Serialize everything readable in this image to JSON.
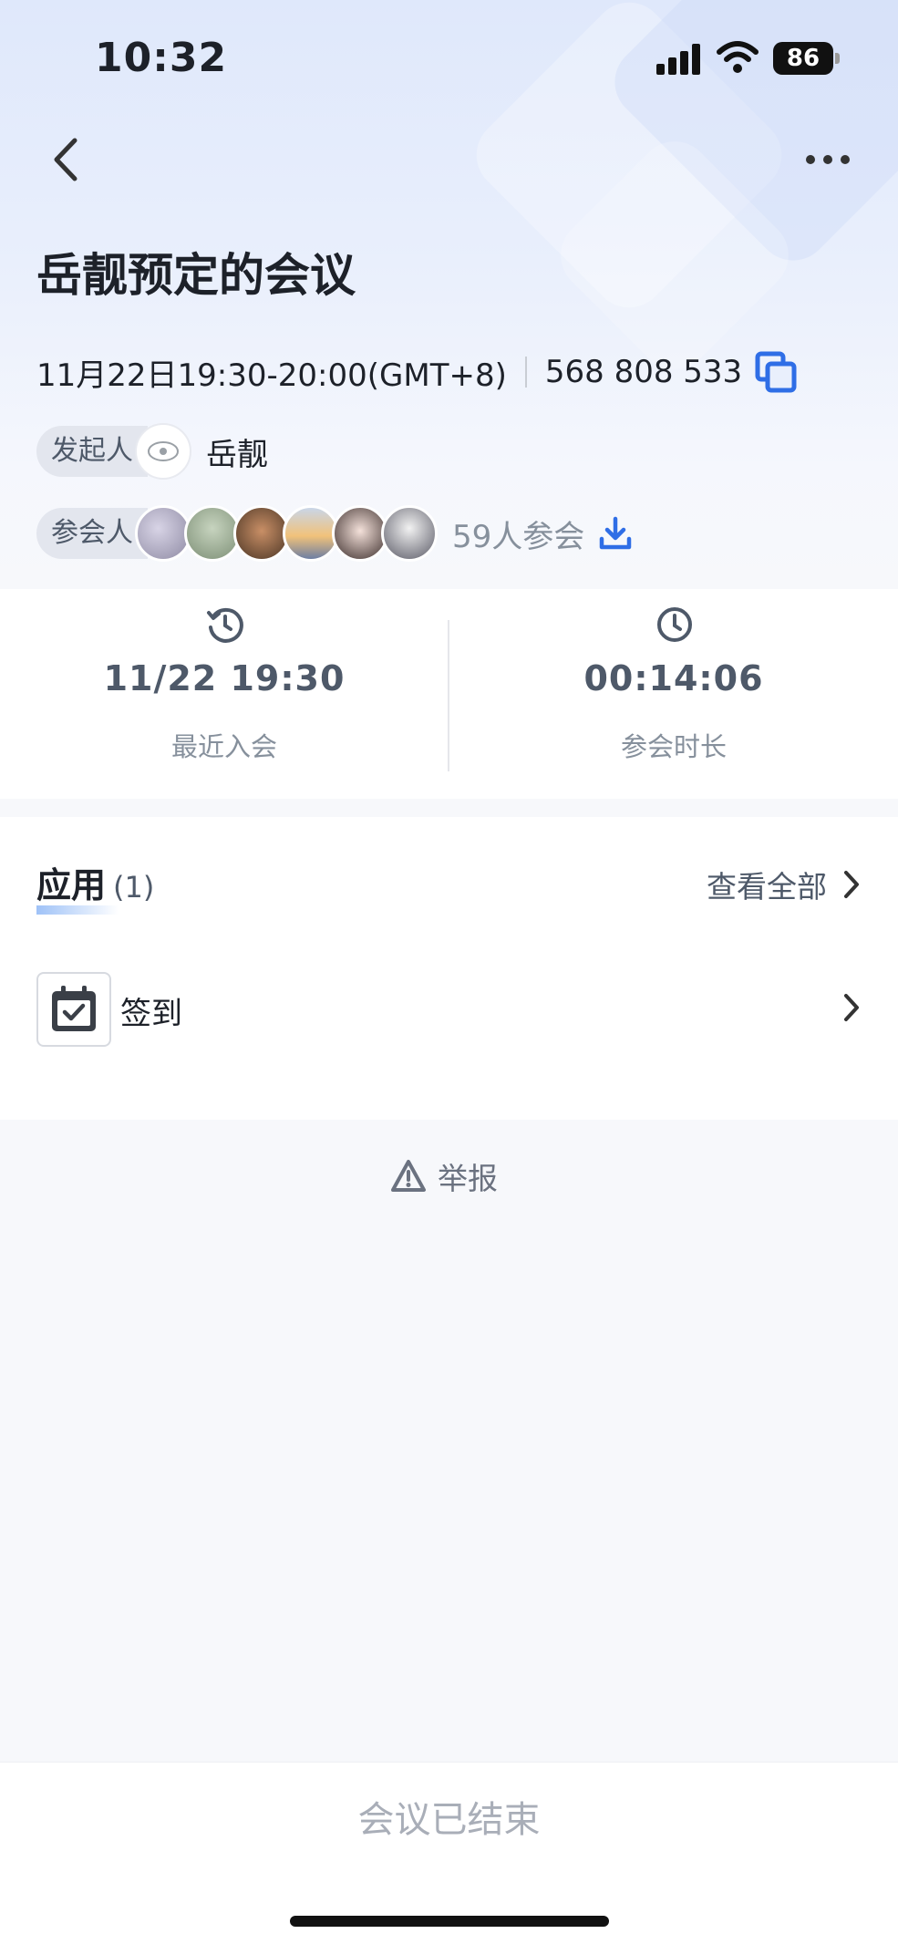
{
  "status_bar": {
    "time": "10:32",
    "battery": "86"
  },
  "nav": {
    "back_icon": "chevron-left-icon",
    "more_icon": "more-horizontal-icon"
  },
  "meeting": {
    "title": "岳靓预定的会议",
    "time_range": "11月22日19:30-20:00(GMT+8)",
    "meeting_id": "568 808 533",
    "host_tag": "发起人",
    "host_name": "岳靓",
    "participants_tag": "参会人",
    "participants_count": "59人参会"
  },
  "stats": {
    "last_join_value": "11/22 19:30",
    "last_join_label": "最近入会",
    "duration_value": "00:14:06",
    "duration_label": "参会时长"
  },
  "apps": {
    "title": "应用",
    "count": "(1)",
    "view_all": "查看全部",
    "items": [
      {
        "label": "签到",
        "icon": "calendar-check-icon"
      }
    ]
  },
  "report": {
    "label": "举报",
    "icon": "warning-triangle-icon"
  },
  "bottom": {
    "status": "会议已结束"
  },
  "colors": {
    "accent": "#2f6ee6",
    "text": "#1d2129",
    "muted": "#86909c"
  }
}
